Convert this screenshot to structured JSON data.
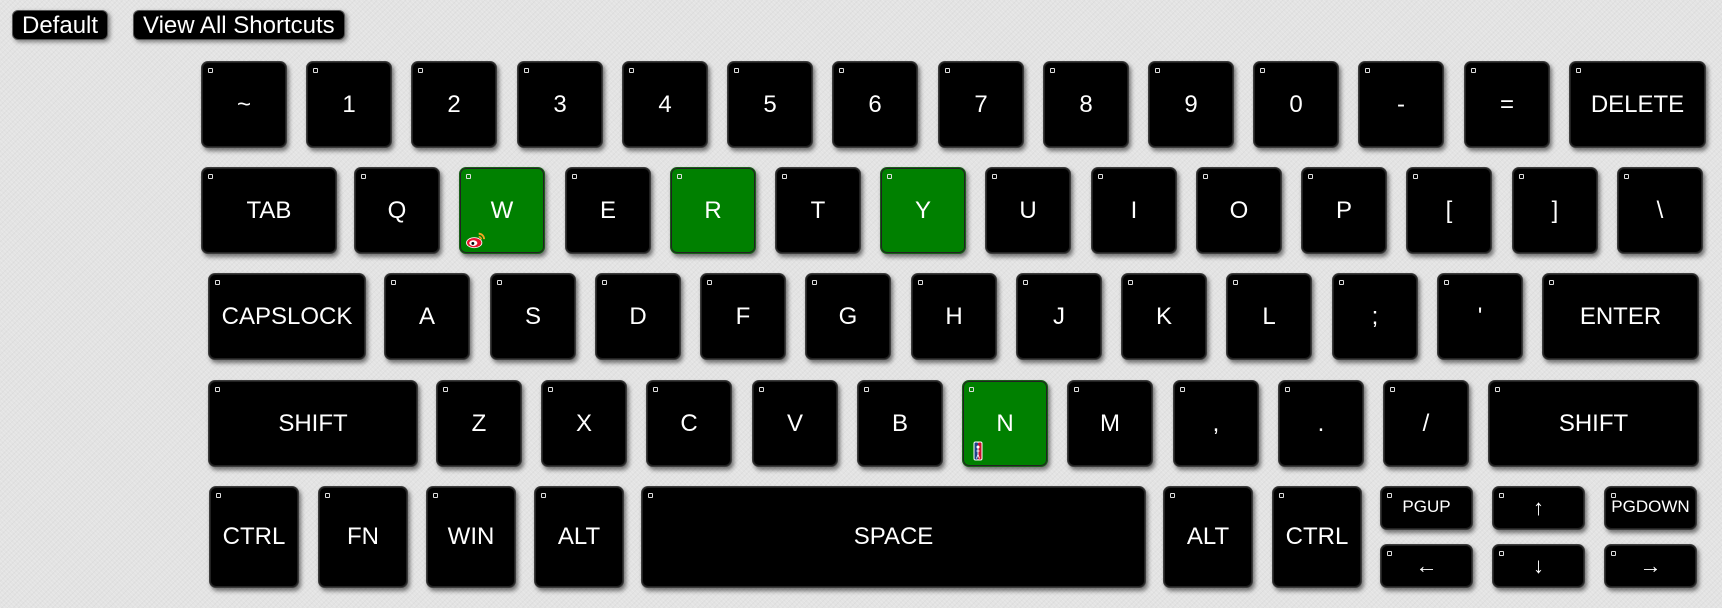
{
  "toolbar": {
    "default_label": "Default",
    "view_all_label": "View All Shortcuts"
  },
  "colors": {
    "key_background": "#000000",
    "key_shortcut_assigned": "#008000",
    "key_text": "#ffffff",
    "page_background": "#e3e3e3"
  },
  "keyboard": {
    "rows": [
      [
        {
          "label": "~"
        },
        {
          "label": "1"
        },
        {
          "label": "2"
        },
        {
          "label": "3"
        },
        {
          "label": "4"
        },
        {
          "label": "5"
        },
        {
          "label": "6"
        },
        {
          "label": "7"
        },
        {
          "label": "8"
        },
        {
          "label": "9"
        },
        {
          "label": "0"
        },
        {
          "label": "-"
        },
        {
          "label": "="
        },
        {
          "label": "DELETE"
        }
      ],
      [
        {
          "label": "TAB"
        },
        {
          "label": "Q"
        },
        {
          "label": "W",
          "assigned": true,
          "app_icon": "weibo-icon"
        },
        {
          "label": "E"
        },
        {
          "label": "R",
          "assigned": true
        },
        {
          "label": "T"
        },
        {
          "label": "Y",
          "assigned": true
        },
        {
          "label": "U"
        },
        {
          "label": "I"
        },
        {
          "label": "O"
        },
        {
          "label": "P"
        },
        {
          "label": "["
        },
        {
          "label": "]"
        },
        {
          "label": "\\"
        }
      ],
      [
        {
          "label": "CAPSLOCK"
        },
        {
          "label": "A"
        },
        {
          "label": "S"
        },
        {
          "label": "D"
        },
        {
          "label": "F"
        },
        {
          "label": "G"
        },
        {
          "label": "H"
        },
        {
          "label": "J"
        },
        {
          "label": "K"
        },
        {
          "label": "L"
        },
        {
          "label": ";"
        },
        {
          "label": "'"
        },
        {
          "label": "ENTER"
        }
      ],
      [
        {
          "label": "SHIFT"
        },
        {
          "label": "Z"
        },
        {
          "label": "X"
        },
        {
          "label": "C"
        },
        {
          "label": "V"
        },
        {
          "label": "B"
        },
        {
          "label": "N",
          "assigned": true,
          "app_icon": "nba-icon"
        },
        {
          "label": "M"
        },
        {
          "label": ","
        },
        {
          "label": "."
        },
        {
          "label": "/"
        },
        {
          "label": "SHIFT"
        }
      ],
      [
        {
          "label": "CTRL"
        },
        {
          "label": "FN"
        },
        {
          "label": "WIN"
        },
        {
          "label": "ALT"
        },
        {
          "label": "SPACE"
        },
        {
          "label": "ALT"
        },
        {
          "label": "CTRL"
        },
        {
          "label": "PGUP"
        },
        {
          "label": "↑"
        },
        {
          "label": "PGDOWN"
        },
        {
          "label": "←"
        },
        {
          "label": "↓"
        },
        {
          "label": "→"
        }
      ]
    ]
  }
}
